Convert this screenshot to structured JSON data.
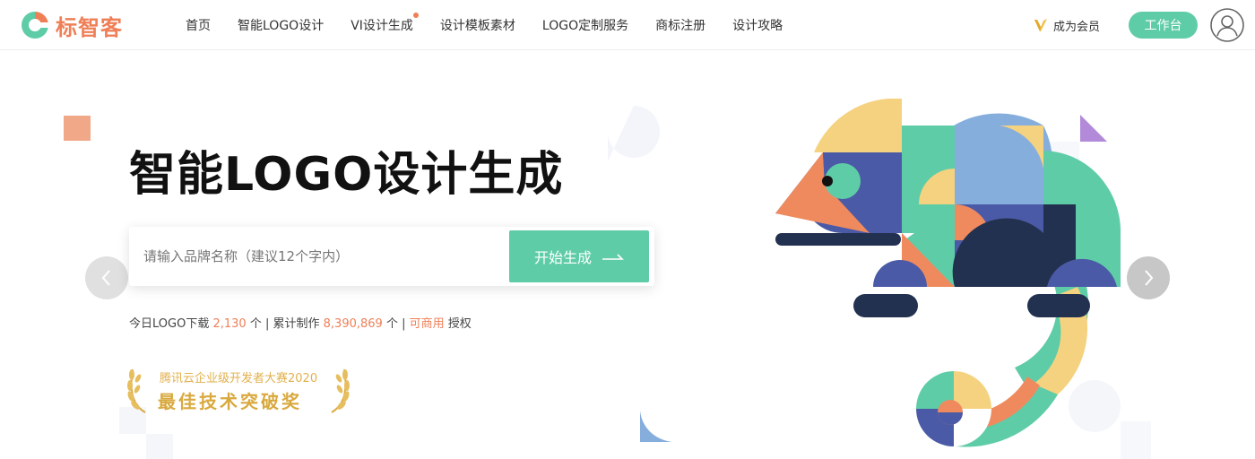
{
  "brand": {
    "name": "标智客"
  },
  "nav": {
    "items": [
      {
        "label": "首页"
      },
      {
        "label": "智能LOGO设计"
      },
      {
        "label": "VI设计生成"
      },
      {
        "label": "设计模板素材"
      },
      {
        "label": "LOGO定制服务"
      },
      {
        "label": "商标注册"
      },
      {
        "label": "设计攻略"
      }
    ]
  },
  "header": {
    "vip_label": "成为会员",
    "workbench_label": "工作台"
  },
  "hero": {
    "title": "智能LOGO设计生成",
    "search": {
      "placeholder": "请输入品牌名称（建议12个字内）",
      "value": ""
    },
    "start_label": "开始生成",
    "stats": {
      "download_prefix": "今日LOGO下载",
      "download_count": "2,130",
      "download_unit": "个 |",
      "made_prefix": "累计制作",
      "made_count": "8,390,869",
      "made_unit": "个 |",
      "commercial": "可商用",
      "license": "授权"
    },
    "award": {
      "subtitle": "腾讯云企业级开发者大赛2020",
      "title": "最佳技术突破奖"
    }
  },
  "colors": {
    "accent_green": "#5fcca8",
    "accent_orange": "#ef7f57",
    "navy": "#233150",
    "indigo": "#4b5aa6",
    "yellow": "#f5d27f",
    "blue": "#86aedd",
    "gold": "#d9a93f"
  },
  "icons": {
    "logo": "logo-icon",
    "vip": "vip-crown-icon",
    "avatar": "user-avatar-icon",
    "arrow": "arrow-right-icon",
    "prev": "chevron-left-icon",
    "next": "chevron-right-icon",
    "laurel": "laurel-icon"
  }
}
